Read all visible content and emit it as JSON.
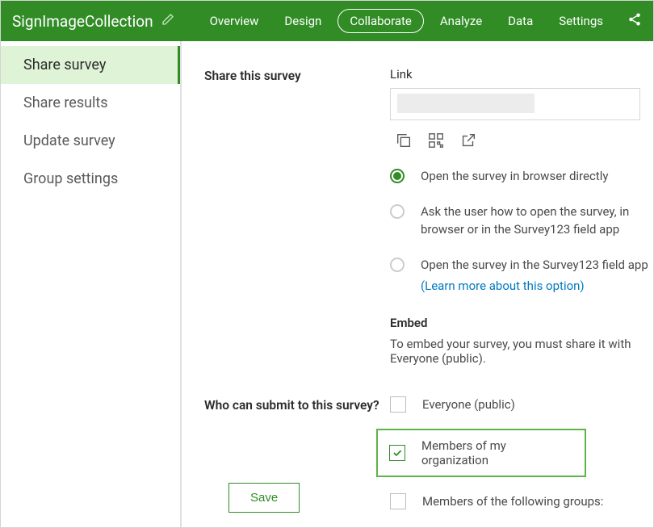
{
  "header": {
    "title": "SignImageCollection",
    "tabs": [
      "Overview",
      "Design",
      "Collaborate",
      "Analyze",
      "Data",
      "Settings"
    ],
    "active_tab": 2
  },
  "sidebar": {
    "items": [
      "Share survey",
      "Share results",
      "Update survey",
      "Group settings"
    ],
    "active": 0
  },
  "share": {
    "section_label": "Share this survey",
    "link_label": "Link",
    "link_value": "",
    "open_options": [
      "Open the survey in browser directly",
      "Ask the user how to open the survey, in browser or in the Survey123 field app",
      "Open the survey in the Survey123 field app"
    ],
    "learn_more": "(Learn more about this option)",
    "selected_option": 0,
    "embed_label": "Embed",
    "embed_text": "To embed your survey, you must share it with Everyone (public)."
  },
  "submit": {
    "section_label": "Who can submit to this survey?",
    "options": [
      "Everyone (public)",
      "Members of my organization",
      "Members of the following groups:"
    ],
    "checked": [
      false,
      true,
      false
    ]
  },
  "buttons": {
    "save": "Save"
  }
}
